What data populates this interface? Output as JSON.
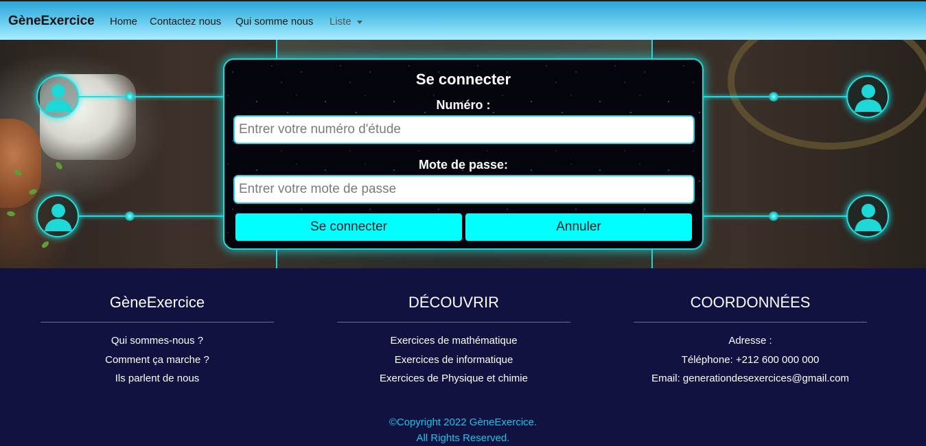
{
  "navbar": {
    "brand": "GèneExercice",
    "links": [
      "Home",
      "Contactez nous",
      "Qui somme nous"
    ],
    "dropdown_label": "Liste"
  },
  "login": {
    "title": "Se connecter",
    "numero_label": "Numéro :",
    "numero_placeholder": "Entrer votre numéro d'étude",
    "password_label": "Mote de passe:",
    "password_placeholder": "Entrer votre mote de passe",
    "submit_label": "Se connecter",
    "cancel_label": "Annuler"
  },
  "footer": {
    "columns": [
      {
        "title": "GèneExercice",
        "items": [
          "Qui sommes-nous ?",
          "Comment ça marche ?",
          "Ils parlent de nous"
        ]
      },
      {
        "title": "DÉCOUVRIR",
        "items": [
          "Exercices de mathématique",
          "Exercices de informatique",
          "Exercices de Physique et chimie"
        ]
      },
      {
        "title": "COORDONNÉES",
        "items": [
          "Adresse :",
          "Téléphone: +212 600 000 000",
          "Email: generationdesexercices@gmail.com"
        ]
      }
    ],
    "copyright_line1": "©Copyright 2022 GèneExercice.",
    "copyright_line2": "All Rights Reserved."
  },
  "colors": {
    "accent": "#00ffff",
    "footer_bg": "#121242",
    "copyright": "#19c6e6"
  }
}
